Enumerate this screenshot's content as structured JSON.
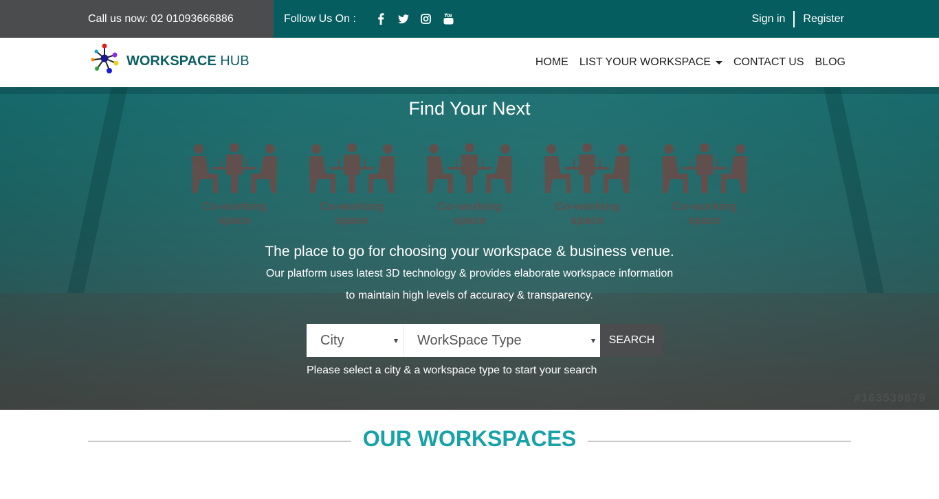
{
  "topbar": {
    "call": "Call us now: 02 01093666886",
    "follow": "Follow Us On :",
    "social": [
      "facebook-icon",
      "twitter-icon",
      "instagram-icon",
      "youtube-icon"
    ],
    "sign_in": "Sign in",
    "register": "Register"
  },
  "brand": {
    "bold": "WORKSPACE",
    "light": " HUB"
  },
  "nav": {
    "home": "HOME",
    "list": "LIST YOUR WORKSPACE",
    "contact": "CONTACT US",
    "blog": "BLOG"
  },
  "hero": {
    "title": "Find Your Next",
    "icons": [
      {
        "l1": "Co-working",
        "l2": "space"
      },
      {
        "l1": "Co-working",
        "l2": "space"
      },
      {
        "l1": "Co-working",
        "l2": "space"
      },
      {
        "l1": "Co-working",
        "l2": "space"
      },
      {
        "l1": "Co-working",
        "l2": "space"
      }
    ],
    "tagline": "The place to go for choosing your workspace & business venue.",
    "desc1": "Our platform uses latest 3D technology & provides elaborate workspace information",
    "desc2": "to maintain high levels of accuracy & transparency.",
    "watermark": "#163539879"
  },
  "search": {
    "city": "City",
    "type": "WorkSpace Type",
    "button": "SEARCH",
    "hint": "Please select a city & a workspace type to start your search"
  },
  "section": {
    "title": "OUR WORKSPACES"
  },
  "colors": {
    "teal_dark": "#055d60",
    "charcoal": "#4b4c4d",
    "accent": "#17a2a8"
  }
}
